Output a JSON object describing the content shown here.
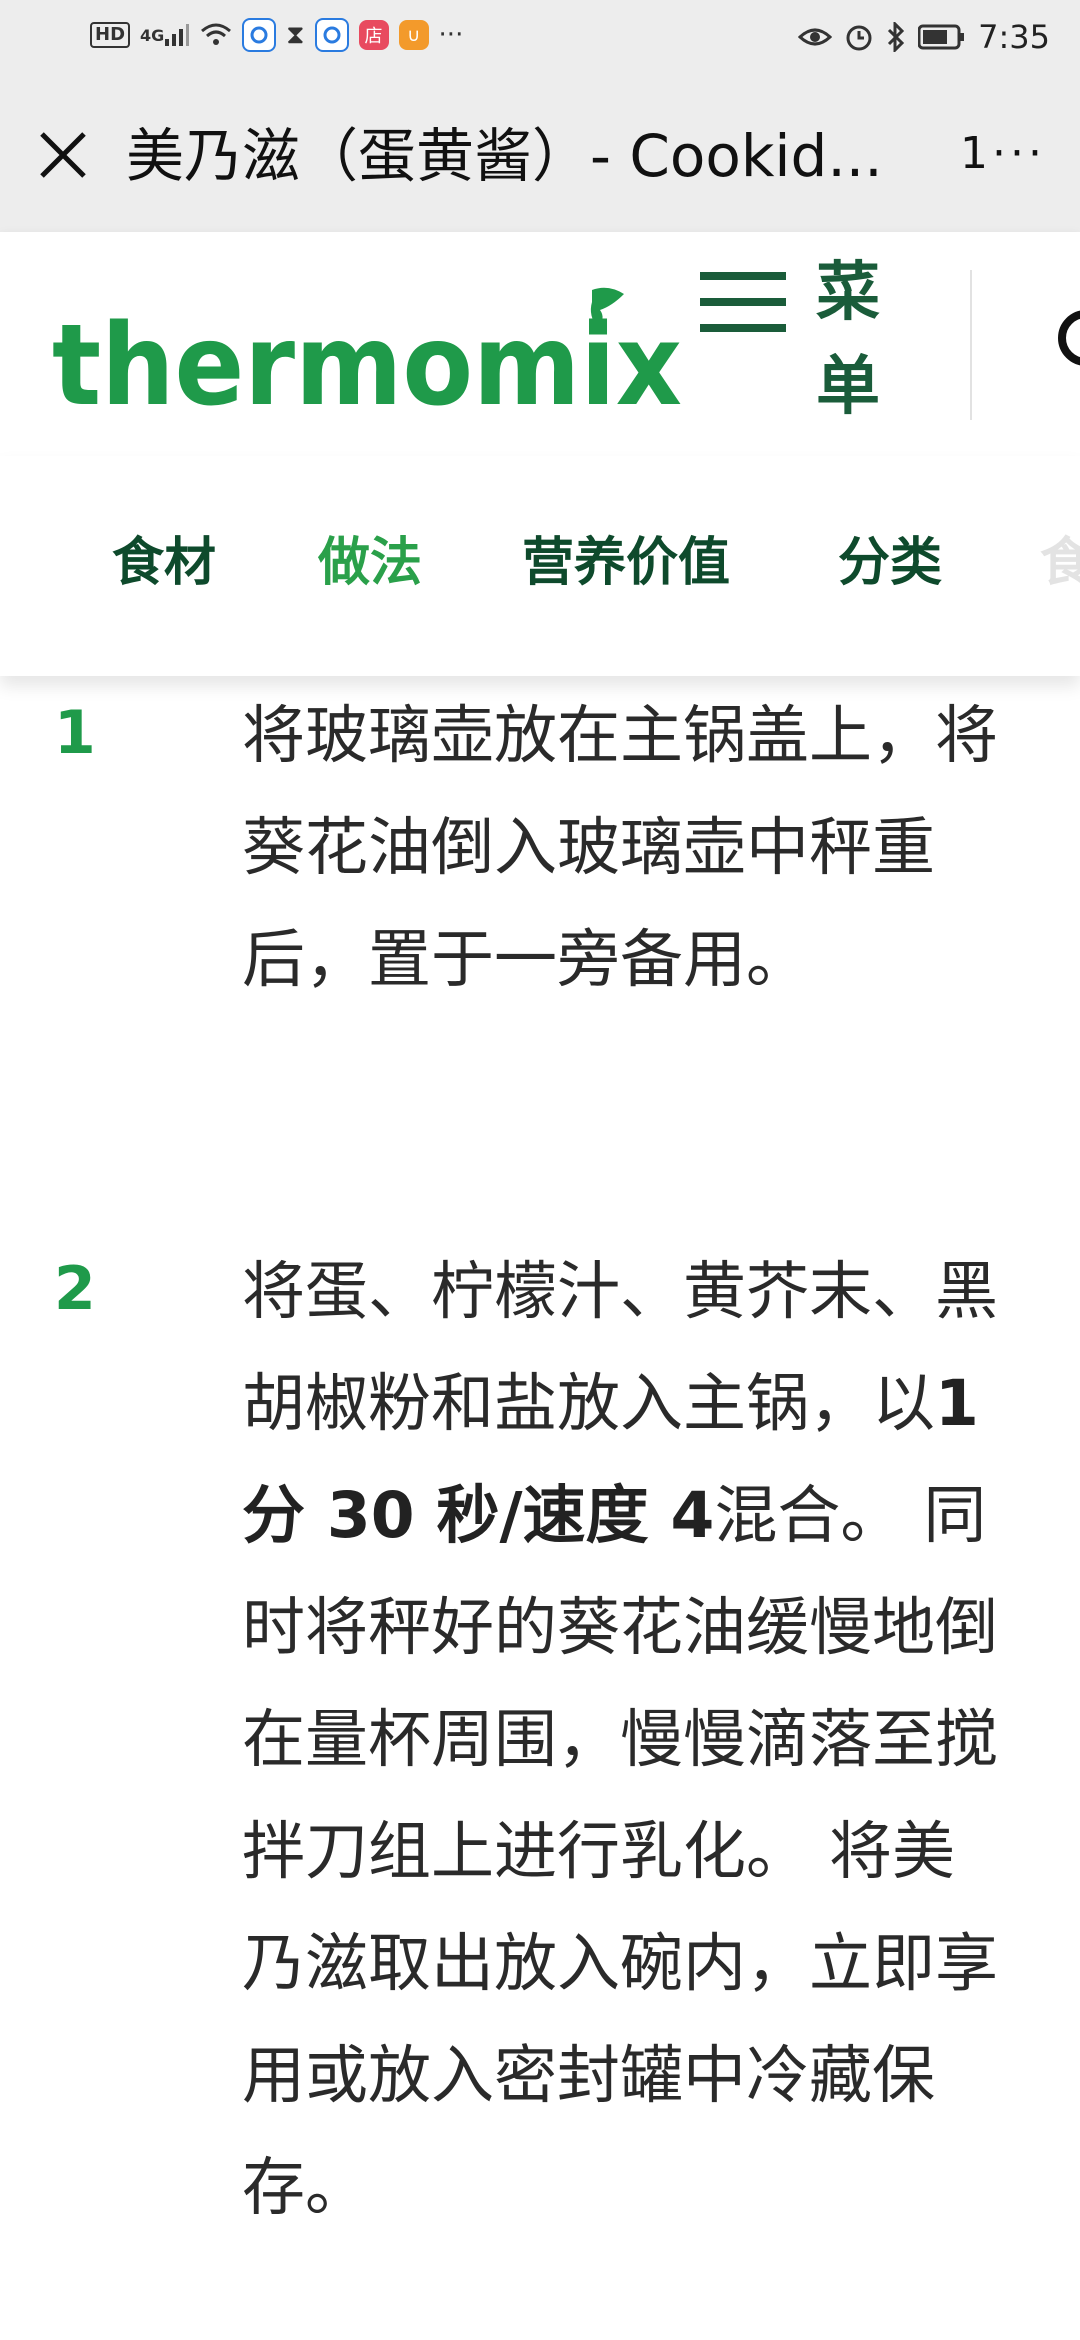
{
  "status_bar": {
    "left_icons": [
      "hd-icon",
      "4g-signal-icon",
      "wifi-icon",
      "browser-icon",
      "hourglass-icon",
      "browser-icon",
      "shop-icon",
      "uc-icon",
      "more-dots-icon"
    ],
    "hd": "HD",
    "network": "4G",
    "more": "···",
    "time": "7:35",
    "right_icons": [
      "eye-icon",
      "alarm-icon",
      "bluetooth-icon",
      "battery-icon"
    ]
  },
  "title_bar": {
    "title": "美乃滋（蛋黄酱）- Cookid...",
    "more_label": "1···"
  },
  "header": {
    "logo_text": "thermomix",
    "menu_label": "菜单",
    "brand_color": "#1f9a4a"
  },
  "tabs": [
    {
      "label": "食材",
      "active": false
    },
    {
      "label": "做法",
      "active": true
    },
    {
      "label": "营养价值",
      "active": false
    },
    {
      "label": "分类",
      "active": false
    },
    {
      "label": "食",
      "active": false
    }
  ],
  "steps": [
    {
      "number": "1",
      "text": "将玻璃壶放在主锅盖上，将葵花油倒入玻璃壶中秤重后，置于一旁备用。"
    },
    {
      "number": "2",
      "text_pre": "将蛋、柠檬汁、黄芥末、黑胡椒粉和盐放入主锅，以",
      "text_bold": "1 分 30 秒/速度 4",
      "text_post": "混合。 同时将秤好的葵花油缓慢地倒在量杯周围，慢慢滴落至搅拌刀组上进行乳化。 将美乃滋取出放入碗内，立即享用或放入密封罐中冷藏保存。"
    }
  ]
}
